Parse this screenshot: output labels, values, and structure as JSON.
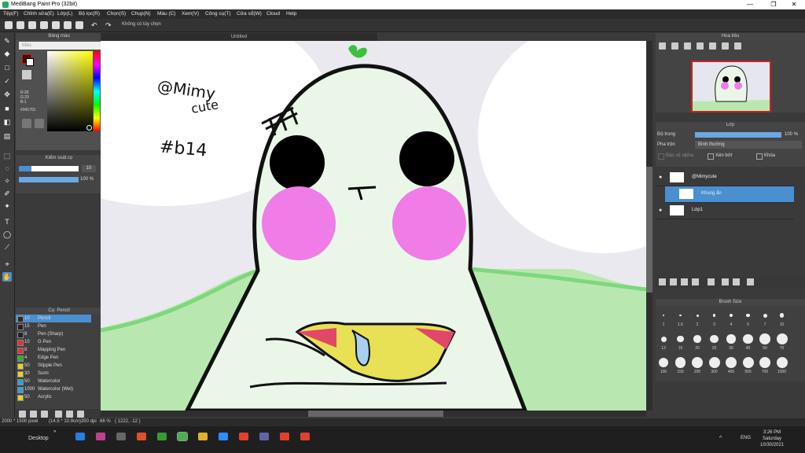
{
  "app": {
    "title": "MediBang Paint Pro (32bit)"
  },
  "menu": [
    "Tệp(F)",
    "Chỉnh sửa(E)",
    "Lớp(L)",
    "Bộ lọc(R)",
    "Chọn(S)",
    "Chụp(N)",
    "Màu (C)",
    "Xem(V)",
    "Công cụ(T)",
    "Cửa sổ(W)",
    "Cloud",
    "Help"
  ],
  "toolbar": {
    "options_label": "Không có tùy chọn"
  },
  "color_panel": {
    "title": "Bảng màu",
    "tab": "Màu",
    "rgb": "R:26\nG:23\nB:1",
    "hex": "#341701"
  },
  "brush_control": {
    "title": "Kiểm soát cọ",
    "size_value": "10",
    "opacity_value": "100",
    "opacity_unit": "%"
  },
  "brush_list": {
    "title": "Cọ: Pencil",
    "items": [
      {
        "size": "10",
        "name": "Pencil",
        "color": "#2a2a2a",
        "selected": true
      },
      {
        "size": "15",
        "name": "Pen",
        "color": "#222222"
      },
      {
        "size": "8",
        "name": "Pen (Sharp)",
        "color": "#222222"
      },
      {
        "size": "10",
        "name": "G Pen",
        "color": "#e53030"
      },
      {
        "size": "8",
        "name": "Mapping Pen",
        "color": "#e53030"
      },
      {
        "size": "4",
        "name": "Edge Pen",
        "color": "#30b030"
      },
      {
        "size": "50",
        "name": "Stipple Pen",
        "color": "#e8d020"
      },
      {
        "size": "30",
        "name": "Sumi",
        "color": "#e8d020"
      },
      {
        "size": "50",
        "name": "Watercolor",
        "color": "#30a0e0"
      },
      {
        "size": "1000",
        "name": "Watercolor (Wet)",
        "color": "#30a0e0"
      },
      {
        "size": "50",
        "name": "Acrylic",
        "color": "#e8d020"
      }
    ]
  },
  "document": {
    "tab_title": "Untitled"
  },
  "canvas_text": {
    "handwriting1": "@Mimy",
    "handwriting2": "cute",
    "tag": "#b14"
  },
  "navigator": {
    "title": "Hoa tiêu"
  },
  "layers": {
    "title": "Lớp",
    "opacity_label": "Độ trong",
    "opacity_value": "100",
    "opacity_unit": "%",
    "blend_label": "Pha trộn",
    "blend_value": "Bình thường",
    "alpha_label": "Bảo vệ alpha",
    "clip_label": "Xén bớt",
    "lock_label": "Khóa",
    "items": [
      {
        "name": "@Mimycute",
        "selected": false,
        "visible": true
      },
      {
        "name": "Khung ẩn",
        "selected": true,
        "visible": false
      },
      {
        "name": "Lớp1",
        "selected": false,
        "visible": true
      }
    ]
  },
  "brush_size": {
    "title": "Brush Size",
    "row1": [
      "1",
      "1.5",
      "2",
      "3",
      "4",
      "5",
      "7",
      "10"
    ],
    "row2": [
      "13",
      "15",
      "20",
      "25",
      "30",
      "40",
      "50",
      "70"
    ],
    "row3": [
      "100",
      "150",
      "200",
      "300",
      "400",
      "500",
      "700",
      "1000"
    ]
  },
  "status": {
    "size": "2000 * 1500 pixel",
    "dims": "(14.5 * 10.9cm)",
    "dpi": "350 dpi",
    "zoom": "66 %",
    "coords": "( 1222, -12 )"
  },
  "taskbar": {
    "desktop_label": "Desktop",
    "lang": "ENG",
    "time": "3:26 PM",
    "day": "Saturday",
    "date": "10/30/2021"
  },
  "colors": {
    "accent": "#4a8fd0",
    "skin": "#eaf7e8",
    "blush": "#f07ce8",
    "leaf": "#7dd87a"
  }
}
